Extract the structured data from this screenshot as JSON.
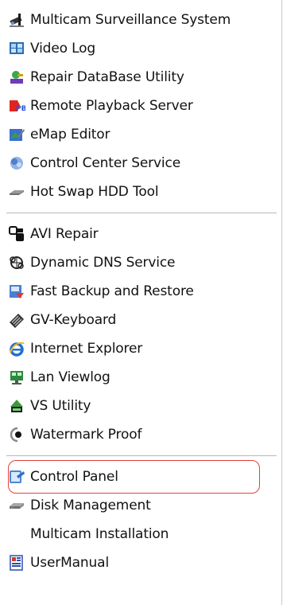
{
  "menu": {
    "groups": [
      {
        "items": [
          {
            "label": "Multicam Surveillance System",
            "icon": "surveillance-system-icon"
          },
          {
            "label": "Video Log",
            "icon": "video-log-icon"
          },
          {
            "label": "Repair DataBase Utility",
            "icon": "repair-database-icon"
          },
          {
            "label": "Remote Playback Server",
            "icon": "remote-playback-icon"
          },
          {
            "label": "eMap Editor",
            "icon": "emap-editor-icon"
          },
          {
            "label": "Control Center Service",
            "icon": "control-center-icon"
          },
          {
            "label": "Hot Swap HDD Tool",
            "icon": "hot-swap-hdd-icon"
          }
        ]
      },
      {
        "items": [
          {
            "label": "AVI Repair",
            "icon": "avi-repair-icon"
          },
          {
            "label": "Dynamic DNS Service",
            "icon": "dynamic-dns-icon"
          },
          {
            "label": "Fast Backup and Restore",
            "icon": "fast-backup-icon"
          },
          {
            "label": "GV-Keyboard",
            "icon": "keyboard-icon"
          },
          {
            "label": "Internet Explorer",
            "icon": "internet-explorer-icon"
          },
          {
            "label": "Lan Viewlog",
            "icon": "lan-viewlog-icon"
          },
          {
            "label": "VS Utility",
            "icon": "vs-utility-icon"
          },
          {
            "label": "Watermark Proof",
            "icon": "watermark-proof-icon"
          }
        ]
      },
      {
        "items": [
          {
            "label": "Control Panel",
            "icon": "control-panel-icon",
            "highlighted": true
          },
          {
            "label": "Disk Management",
            "icon": "disk-management-icon"
          },
          {
            "label": "Multicam Installation",
            "icon": ""
          },
          {
            "label": "UserManual",
            "icon": "user-manual-icon"
          }
        ]
      }
    ]
  },
  "colors": {
    "highlight_border": "#e3423d",
    "separator": "#b8b8b8"
  }
}
